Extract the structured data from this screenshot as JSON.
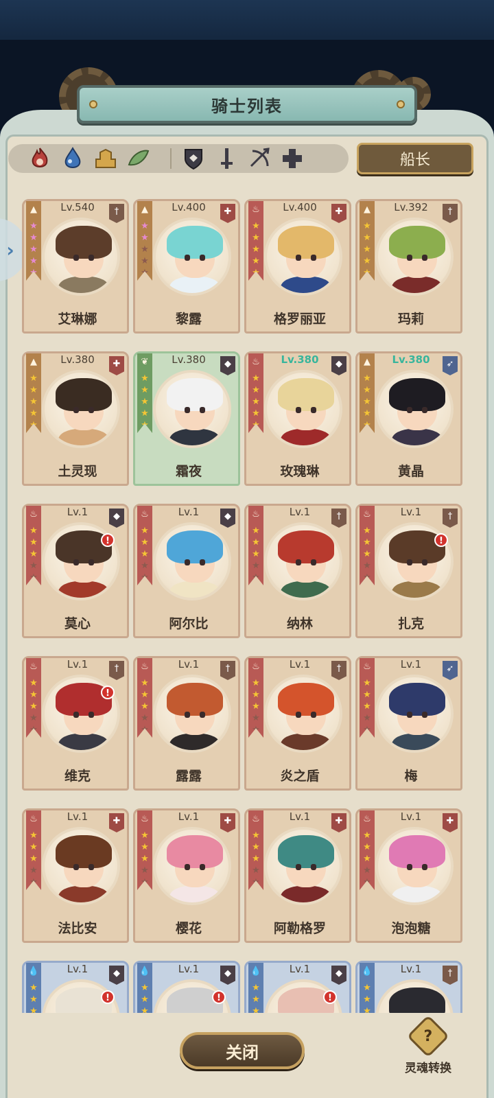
{
  "header": {
    "title": "骑士列表"
  },
  "filters": {
    "elements": [
      {
        "icon": "fire-icon",
        "color": "#b8423c"
      },
      {
        "icon": "water-drop-icon",
        "color": "#3f74b8"
      },
      {
        "icon": "earth-icon",
        "color": "#c79b46"
      },
      {
        "icon": "wind-leaf-icon",
        "color": "#6e9c62"
      }
    ],
    "classes": [
      {
        "icon": "shield-icon"
      },
      {
        "icon": "sword-icon"
      },
      {
        "icon": "bow-icon"
      },
      {
        "icon": "cross-heal-icon"
      }
    ],
    "captain_label": "船长"
  },
  "knights": [
    {
      "name": "艾琳娜",
      "level": "Lv.540",
      "element": "earth",
      "class": "sword",
      "stars": 5,
      "star_style": "pink",
      "hair": "#5c3d2a",
      "outfit": "#8a7a60"
    },
    {
      "name": "黎露",
      "level": "Lv.400",
      "element": "earth",
      "class": "heal",
      "stars": 2,
      "star_style": "pink",
      "hair": "#79d4d2",
      "outfit": "#e9f1f6"
    },
    {
      "name": "格罗丽亚",
      "level": "Lv.400",
      "element": "fire",
      "class": "heal",
      "stars": 5,
      "star_style": "gold",
      "hair": "#e3b86a",
      "outfit": "#2e4a8a"
    },
    {
      "name": "玛莉",
      "level": "Lv.392",
      "element": "earth",
      "class": "sword",
      "stars": 5,
      "star_style": "gold",
      "hair": "#8cae4e",
      "outfit": "#7a2c2a"
    },
    {
      "name": "土灵现",
      "level": "Lv.380",
      "element": "earth",
      "class": "heal",
      "stars": 5,
      "star_style": "gold",
      "hair": "#3a2c22",
      "outfit": "#d6a97a"
    },
    {
      "name": "霜夜",
      "level": "Lv.380",
      "element": "wind",
      "class": "shield",
      "stars": 5,
      "star_style": "gold",
      "hair": "#f2f2f2",
      "outfit": "#2f3540",
      "highlight": "green"
    },
    {
      "name": "玫瑰琳",
      "level": "Lv.380",
      "element": "fire",
      "class": "shield",
      "stars": 5,
      "star_style": "gold",
      "hair": "#e8d49a",
      "outfit": "#9e2a2a",
      "level_style": "teal"
    },
    {
      "name": "黄晶",
      "level": "Lv.380",
      "element": "earth",
      "class": "bow",
      "stars": 5,
      "star_style": "gold",
      "hair": "#1e1c22",
      "outfit": "#3a3448",
      "level_style": "teal"
    },
    {
      "name": "莫心",
      "level": "Lv.1",
      "element": "fire",
      "class": "shield",
      "stars": 3,
      "star_style": "gold",
      "hair": "#4a3528",
      "outfit": "#a23a2a",
      "alert": true
    },
    {
      "name": "阿尔比",
      "level": "Lv.1",
      "element": "fire",
      "class": "shield",
      "stars": 3,
      "star_style": "gold",
      "hair": "#4fa6d8",
      "outfit": "#f0e4c4"
    },
    {
      "name": "纳林",
      "level": "Lv.1",
      "element": "fire",
      "class": "sword",
      "stars": 3,
      "star_style": "gold",
      "hair": "#b83a2e",
      "outfit": "#3f6b4e"
    },
    {
      "name": "扎克",
      "level": "Lv.1",
      "element": "fire",
      "class": "sword",
      "stars": 3,
      "star_style": "gold",
      "hair": "#5a3b28",
      "outfit": "#9a7a4a",
      "alert": true
    },
    {
      "name": "维克",
      "level": "Lv.1",
      "element": "fire",
      "class": "sword",
      "stars": 3,
      "star_style": "gold",
      "hair": "#b02e2e",
      "outfit": "#3a3a44",
      "alert": true
    },
    {
      "name": "露露",
      "level": "Lv.1",
      "element": "fire",
      "class": "sword",
      "stars": 3,
      "star_style": "gold",
      "hair": "#c25a30",
      "outfit": "#2e2a2a"
    },
    {
      "name": "炎之盾",
      "level": "Lv.1",
      "element": "fire",
      "class": "sword",
      "stars": 3,
      "star_style": "gold",
      "hair": "#d4542c",
      "outfit": "#6a3a2a"
    },
    {
      "name": "梅",
      "level": "Lv.1",
      "element": "fire",
      "class": "bow",
      "stars": 3,
      "star_style": "gold",
      "hair": "#2e3a6a",
      "outfit": "#3a4a5a"
    },
    {
      "name": "法比安",
      "level": "Lv.1",
      "element": "fire",
      "class": "heal",
      "stars": 3,
      "star_style": "gold",
      "hair": "#6a3a22",
      "outfit": "#8a3a2a"
    },
    {
      "name": "樱花",
      "level": "Lv.1",
      "element": "fire",
      "class": "heal",
      "stars": 3,
      "star_style": "gold",
      "hair": "#e88aa2",
      "outfit": "#f4e6e6"
    },
    {
      "name": "阿勒格罗",
      "level": "Lv.1",
      "element": "fire",
      "class": "heal",
      "stars": 3,
      "star_style": "gold",
      "hair": "#3f8a84",
      "outfit": "#7a2a2a"
    },
    {
      "name": "泡泡糖",
      "level": "Lv.1",
      "element": "fire",
      "class": "heal",
      "stars": 3,
      "star_style": "gold",
      "hair": "#e07ab4",
      "outfit": "#f0f0f0"
    },
    {
      "name": "",
      "level": "Lv.1",
      "element": "water",
      "class": "shield",
      "stars": 3,
      "star_style": "gold",
      "hair": "#e9e2d4",
      "outfit": "#aaa",
      "alert": true,
      "highlight": "blue"
    },
    {
      "name": "",
      "level": "Lv.1",
      "element": "water",
      "class": "shield",
      "stars": 3,
      "star_style": "gold",
      "hair": "#cfcfcf",
      "outfit": "#aaa",
      "alert": true,
      "highlight": "blue"
    },
    {
      "name": "",
      "level": "Lv.1",
      "element": "water",
      "class": "shield",
      "stars": 3,
      "star_style": "gold",
      "hair": "#e8bfb2",
      "outfit": "#aaa",
      "alert": true,
      "highlight": "blue"
    },
    {
      "name": "",
      "level": "Lv.1",
      "element": "water",
      "class": "sword",
      "stars": 3,
      "star_style": "gold",
      "hair": "#2a2a30",
      "outfit": "#aaa",
      "highlight": "blue"
    }
  ],
  "footer": {
    "close_label": "关闭",
    "soul_label": "灵魂转换",
    "soul_icon": "?"
  }
}
